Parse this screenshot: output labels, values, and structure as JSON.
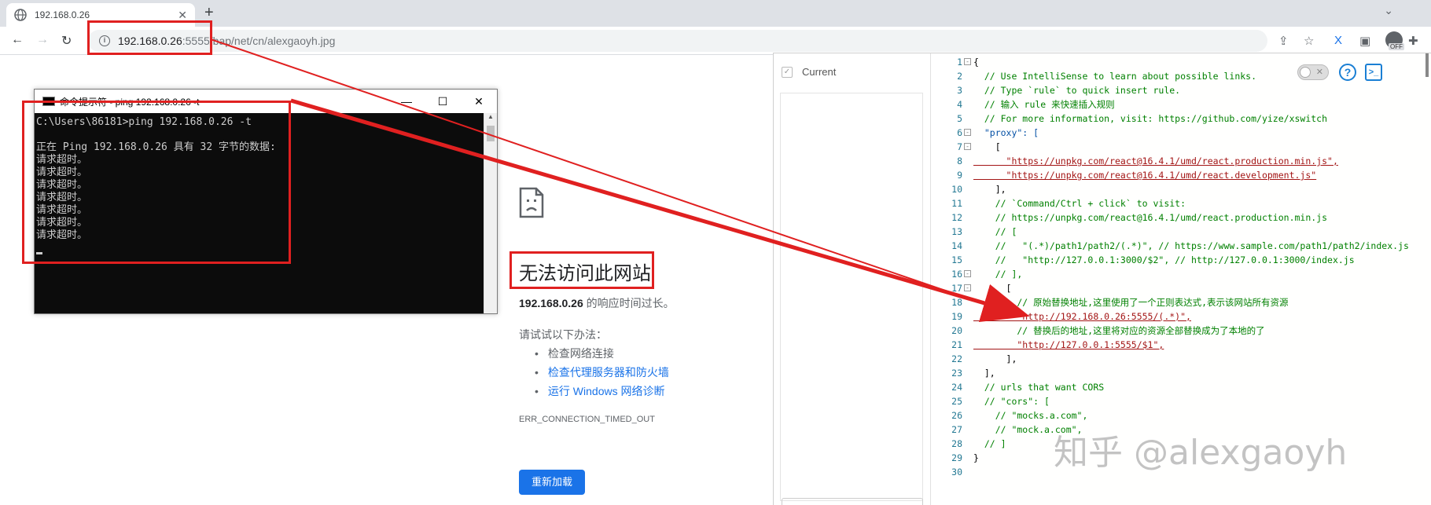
{
  "browser": {
    "tab_title": "192.168.0.26",
    "tab_close": "✕",
    "new_tab": "+",
    "tab_chevron": "⌄",
    "url_host": "192.168.0.26",
    "url_rest": ":5555/bap/net/cn/alexgaoyh.jpg",
    "off_badge": "OFF"
  },
  "error_page": {
    "title": "无法访问此网站",
    "desc_host": "192.168.0.26",
    "desc_rest": " 的响应时间过长。",
    "try_label": "请试试以下办法：",
    "suggestions": [
      "检查网络连接",
      "检查代理服务器和防火墙",
      "运行 Windows 网络诊断"
    ],
    "error_code": "ERR_CONNECTION_TIMED_OUT",
    "reload_button": "重新加载"
  },
  "cmd": {
    "title": "命令提示符 - ping  192.168.0.26  -t",
    "output": "C:\\Users\\86181>ping 192.168.0.26 -t\n\n正在 Ping 192.168.0.26 具有 32 字节的数据:\n请求超时。\n请求超时。\n请求超时。\n请求超时。\n请求超时。\n请求超时。\n请求超时。"
  },
  "panel": {
    "current_label": "Current",
    "toggle_x": "✕",
    "help_icon": "?",
    "terminal_icon": ">_"
  },
  "editor_lines": [
    "{",
    "  // Use IntelliSense to learn about possible links.",
    "  // Type `rule` to quick insert rule.",
    "  // 输入 rule 来快速插入规则",
    "  // For more information, visit: https://github.com/yize/xswitch",
    "  \"proxy\": [",
    "    [",
    "      \"https://unpkg.com/react@16.4.1/umd/react.production.min.js\",",
    "      \"https://unpkg.com/react@16.4.1/umd/react.development.js\"",
    "    ],",
    "    // `Command/Ctrl + click` to visit:",
    "    // https://unpkg.com/react@16.4.1/umd/react.production.min.js",
    "    // [",
    "    //   \"(.*)/path1/path2/(.*)\", // https://www.sample.com/path1/path2/index.js",
    "    //   \"http://127.0.0.1:3000/$2\", // http://127.0.0.1:3000/index.js",
    "    // ],",
    "      [",
    "        // 原始替换地址,这里使用了一个正则表达式,表示该网站所有资源",
    "        \"http://192.168.0.26:5555/(.*)\",",
    "        // 替换后的地址,这里将对应的资源全部替换成为了本地的了",
    "        \"http://127.0.0.1:5555/$1\",",
    "      ],",
    "  ],",
    "  // urls that want CORS",
    "  // \"cors\": [",
    "    // \"mocks.a.com\",",
    "    // \"mock.a.com\",",
    "  // ]",
    "}",
    ""
  ],
  "watermark": "知乎 @alexgaoyh"
}
